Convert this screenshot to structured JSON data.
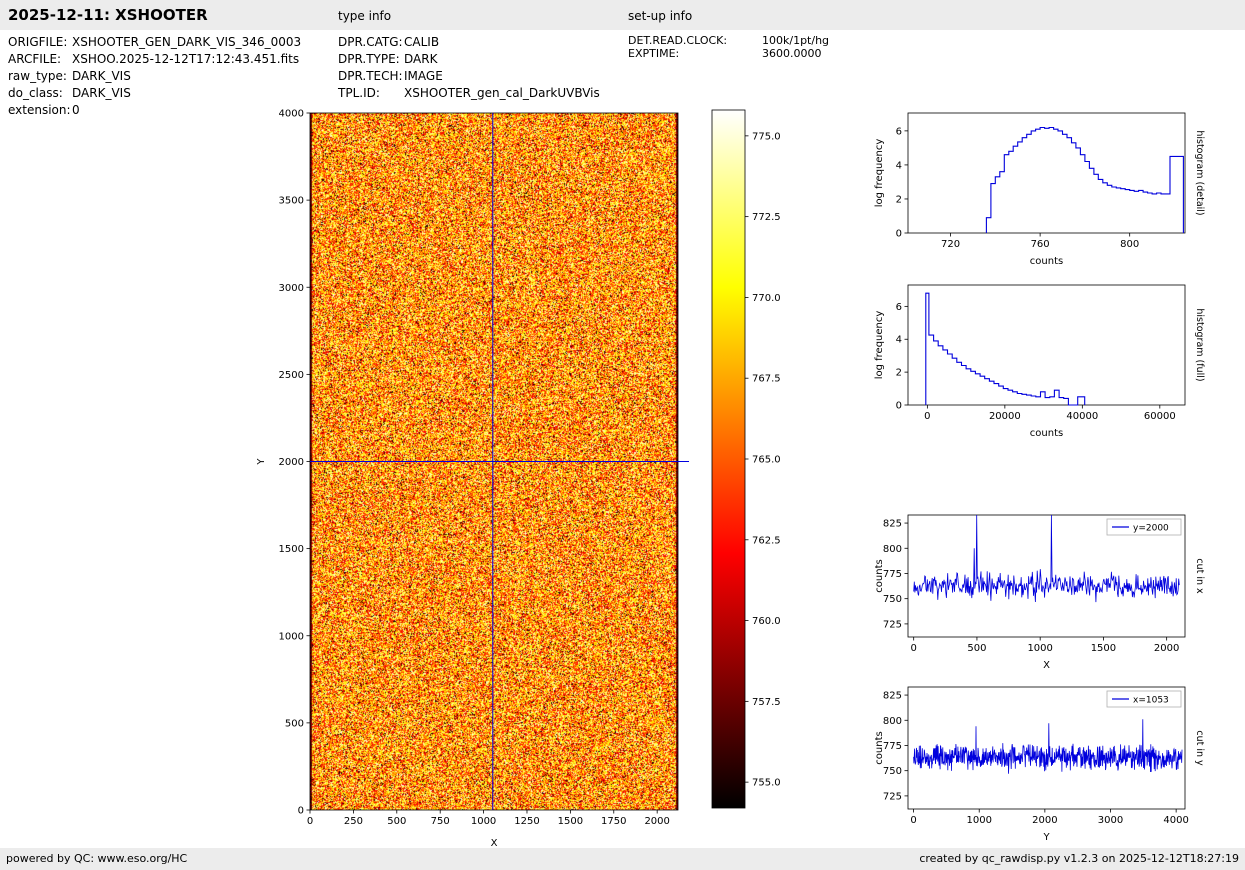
{
  "header": {
    "title": "2025-12-11: XSHOOTER",
    "type_info_heading": "type info",
    "setup_info_heading": "set-up info"
  },
  "file_info": {
    "rows": [
      {
        "label": "ORIGFILE:",
        "value": "XSHOOTER_GEN_DARK_VIS_346_0003"
      },
      {
        "label": "ARCFILE:",
        "value": "XSHOO.2025-12-12T17:12:43.451.fits"
      },
      {
        "label": "raw_type:",
        "value": "DARK_VIS"
      },
      {
        "label": "do_class:",
        "value": "DARK_VIS"
      },
      {
        "label": "extension:",
        "value": "0"
      }
    ]
  },
  "type_info": {
    "rows": [
      {
        "label": "DPR.CATG:",
        "value": "CALIB"
      },
      {
        "label": "DPR.TYPE:",
        "value": "DARK"
      },
      {
        "label": "DPR.TECH:",
        "value": "IMAGE"
      },
      {
        "label": "TPL.ID:",
        "value": "XSHOOTER_gen_cal_DarkUVBVis"
      }
    ]
  },
  "setup_info": {
    "rows": [
      {
        "label": "DET.READ.CLOCK:",
        "value": "100k/1pt/hg"
      },
      {
        "label": "EXPTIME:",
        "value": "3600.0000"
      }
    ]
  },
  "footer": {
    "left": "powered by QC: www.eso.org/HC",
    "right": "created by qc_rawdisp.py v1.2.3 on 2025-12-12T18:27:19"
  },
  "colors": {
    "line_blue": "#0000dd",
    "crosshair_blue": "#0000e0",
    "strip_gray": "#ececec"
  },
  "chart_data": [
    {
      "id": "main",
      "type": "heatmap",
      "title": "raw dark frame",
      "xlabel": "X",
      "ylabel": "Y",
      "xlim": [
        0,
        2120
      ],
      "ylim": [
        0,
        4000
      ],
      "xticks": [
        0,
        250,
        500,
        750,
        1000,
        1250,
        1500,
        1750,
        2000
      ],
      "yticks": [
        0,
        500,
        1000,
        1500,
        2000,
        2500,
        3000,
        3500,
        4000
      ],
      "colormap": "hot",
      "noise_seed": 5,
      "value_range_counts": [
        755.0,
        775.0
      ],
      "crosshair": {
        "x": 1053,
        "y": 2000
      },
      "colorbar": {
        "vmin": 754.2,
        "vmax": 775.8,
        "ticks": [
          775.0,
          772.5,
          770.0,
          767.5,
          765.0,
          762.5,
          760.0,
          757.5,
          755.0
        ]
      }
    },
    {
      "id": "hist_detail",
      "type": "line",
      "xlabel": "counts",
      "ylabel": "log frequency",
      "right_label": "histogram (detail)",
      "xlim": [
        701,
        824.7
      ],
      "ylim": [
        0,
        7.05
      ],
      "xticks": [
        720,
        760,
        800
      ],
      "yticks": [
        0,
        2,
        4,
        6
      ],
      "steps": {
        "x": [
          736,
          738,
          740,
          742,
          744,
          746,
          748,
          750,
          752,
          754,
          756,
          758,
          760,
          762,
          764,
          766,
          768,
          770,
          772,
          774,
          776,
          778,
          780,
          782,
          784,
          786,
          788,
          790,
          792,
          794,
          796,
          798,
          800,
          802,
          804,
          806,
          808,
          810,
          812,
          814,
          818,
          824
        ],
        "y": [
          0.9,
          2.9,
          3.3,
          3.6,
          4.6,
          4.8,
          5.1,
          5.35,
          5.6,
          5.8,
          6.0,
          6.1,
          6.2,
          6.15,
          6.2,
          6.1,
          6.0,
          5.8,
          5.6,
          5.3,
          5.0,
          4.6,
          4.2,
          3.8,
          3.45,
          3.15,
          2.95,
          2.8,
          2.7,
          2.65,
          2.6,
          2.55,
          2.5,
          2.45,
          2.5,
          2.4,
          2.35,
          2.3,
          2.35,
          2.3,
          4.5
        ]
      }
    },
    {
      "id": "hist_full",
      "type": "line",
      "xlabel": "counts",
      "ylabel": "log frequency",
      "right_label": "histogram (full)",
      "xlim": [
        -5000,
        66500
      ],
      "ylim": [
        0,
        7.3
      ],
      "xticks": [
        0,
        20000,
        40000,
        60000
      ],
      "yticks": [
        0,
        2,
        4,
        6
      ],
      "steps": {
        "x": [
          -400,
          400,
          1600,
          2800,
          4000,
          5200,
          6400,
          7600,
          8800,
          10000,
          11200,
          12400,
          13600,
          14800,
          16000,
          17200,
          18400,
          19600,
          20800,
          22000,
          23200,
          24400,
          25600,
          26800,
          28000,
          29200,
          30400,
          31600,
          32800,
          34000,
          35200,
          36400,
          38800,
          40600
        ],
        "y": [
          6.8,
          4.25,
          3.9,
          3.6,
          3.35,
          3.1,
          2.85,
          2.6,
          2.4,
          2.2,
          2.05,
          1.9,
          1.75,
          1.6,
          1.45,
          1.3,
          1.15,
          1.0,
          0.9,
          0.8,
          0.7,
          0.65,
          0.6,
          0.55,
          0.5,
          0.8,
          0.45,
          0.5,
          0.9,
          0.45,
          0.4,
          0.0,
          0.5
        ]
      }
    },
    {
      "id": "cut_x",
      "type": "line",
      "xlabel": "X",
      "ylabel": "counts",
      "right_label": "cut in x",
      "legend": "y=2000",
      "xlim": [
        -45,
        2145
      ],
      "ylim": [
        712,
        833
      ],
      "xticks": [
        0,
        500,
        1000,
        1500,
        2000
      ],
      "yticks": [
        725,
        750,
        775,
        800,
        825
      ],
      "noise": {
        "baseline": 763,
        "amplitude": 7,
        "n": 430,
        "x0": 0,
        "x1": 2100,
        "seed": 11
      },
      "spikes": [
        {
          "x": 480,
          "y": 800
        },
        {
          "x": 500,
          "y": 833
        },
        {
          "x": 1090,
          "y": 833
        }
      ]
    },
    {
      "id": "cut_y",
      "type": "line",
      "xlabel": "Y",
      "ylabel": "counts",
      "right_label": "cut in y",
      "legend": "x=1053",
      "xlim": [
        -85,
        4135
      ],
      "ylim": [
        712,
        833
      ],
      "xticks": [
        0,
        1000,
        2000,
        3000,
        4000
      ],
      "yticks": [
        725,
        750,
        775,
        800,
        825
      ],
      "noise": {
        "baseline": 763,
        "amplitude": 7,
        "n": 800,
        "x0": 0,
        "x1": 4090,
        "seed": 23
      },
      "spikes": [
        {
          "x": 950,
          "y": 794
        },
        {
          "x": 2060,
          "y": 797
        },
        {
          "x": 3490,
          "y": 801
        }
      ]
    }
  ]
}
